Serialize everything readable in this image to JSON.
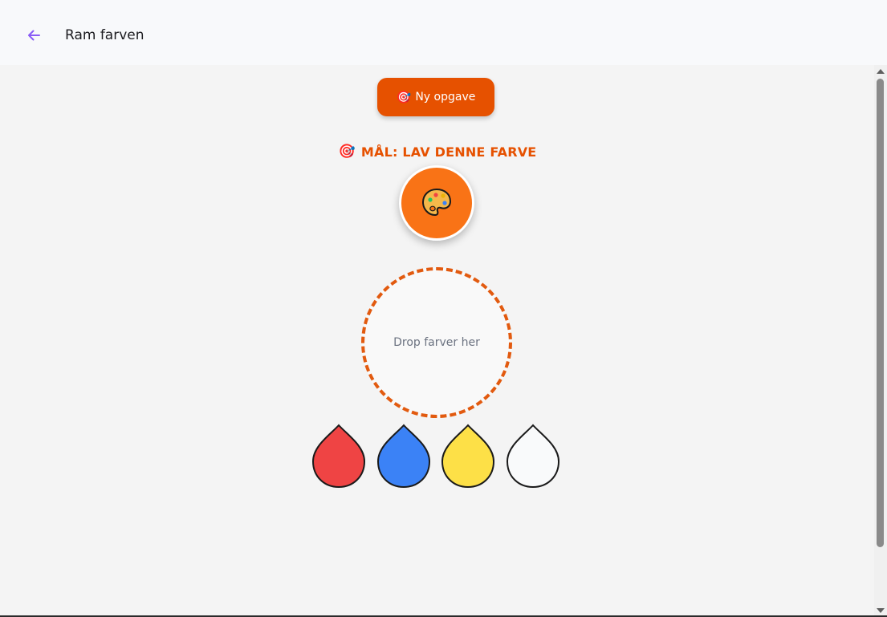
{
  "header": {
    "title": "Ram farven",
    "back_icon": "arrow-left-icon"
  },
  "actions": {
    "new_task_emoji": "🎯",
    "new_task_label": "Ny opgave"
  },
  "goal": {
    "emoji": "🎯",
    "label": "MÅL: LAV DENNE FARVE",
    "target_color": "#f97316",
    "target_icon": "palette-icon"
  },
  "mixing": {
    "placeholder": "Drop farver her"
  },
  "paints": [
    {
      "name": "red",
      "color": "#ef4444"
    },
    {
      "name": "blue",
      "color": "#3b82f6"
    },
    {
      "name": "yellow",
      "color": "#fde047"
    },
    {
      "name": "white",
      "color": "#f9fafb"
    }
  ],
  "colors": {
    "accent": "#e65100",
    "back_arrow": "#8a5cf6"
  }
}
